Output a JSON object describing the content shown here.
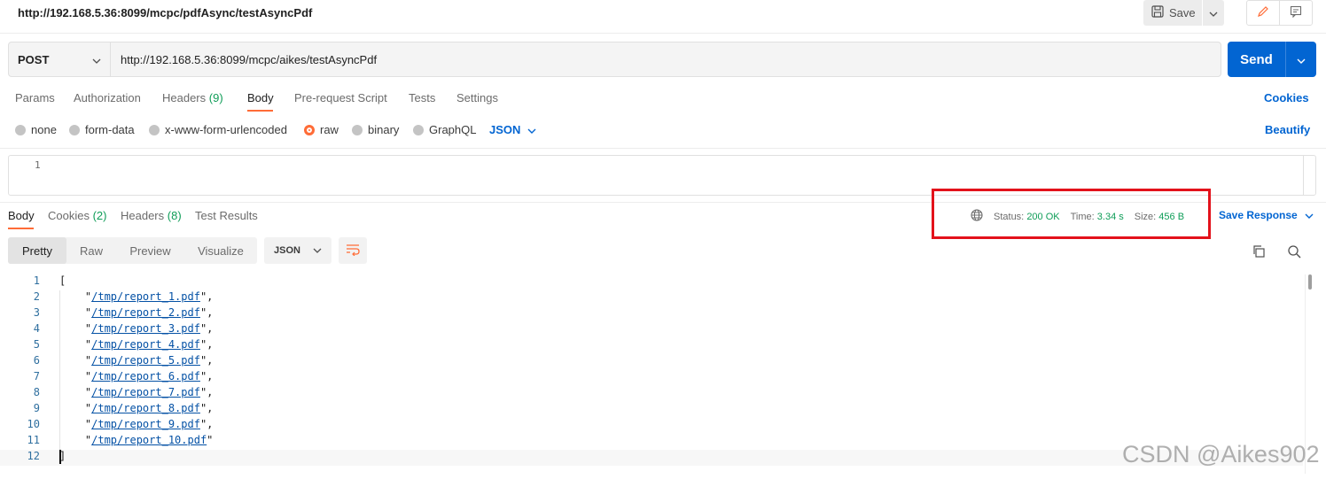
{
  "request": {
    "title": "http://192.168.5.36:8099/mcpc/pdfAsync/testAsyncPdf",
    "save_label": "Save",
    "method": "POST",
    "url": "http://192.168.5.36:8099/mcpc/aikes/testAsyncPdf",
    "send_label": "Send"
  },
  "request_tabs": [
    {
      "label": "Params",
      "count": ""
    },
    {
      "label": "Authorization",
      "count": ""
    },
    {
      "label": "Headers",
      "count": "(9)"
    },
    {
      "label": "Body",
      "count": ""
    },
    {
      "label": "Pre-request Script",
      "count": ""
    },
    {
      "label": "Tests",
      "count": ""
    },
    {
      "label": "Settings",
      "count": ""
    }
  ],
  "active_request_tab": "Body",
  "cookies_label": "Cookies",
  "body_types": [
    "none",
    "form-data",
    "x-www-form-urlencoded",
    "raw",
    "binary",
    "GraphQL"
  ],
  "selected_body_type": "raw",
  "raw_language": "JSON",
  "beautify_label": "Beautify",
  "request_editor": {
    "line_numbers": [
      "1"
    ]
  },
  "response_tabs": [
    {
      "label": "Body",
      "count": ""
    },
    {
      "label": "Cookies",
      "count": "(2)"
    },
    {
      "label": "Headers",
      "count": "(8)"
    },
    {
      "label": "Test Results",
      "count": ""
    }
  ],
  "status": {
    "status_label": "Status:",
    "status_value": "200 OK",
    "time_label": "Time:",
    "time_value": "3.34 s",
    "size_label": "Size:",
    "size_value": "456 B",
    "highlight_color": "#e3121b"
  },
  "save_response_label": "Save Response",
  "view_modes": [
    "Pretty",
    "Raw",
    "Preview",
    "Visualize"
  ],
  "active_view_mode": "Pretty",
  "response_format": "JSON",
  "response_lines": [
    {
      "num": "1",
      "pre": "[",
      "str": "",
      "post": ""
    },
    {
      "num": "2",
      "pre": "    \"",
      "str": "/tmp/report_1.pdf",
      "post": "\","
    },
    {
      "num": "3",
      "pre": "    \"",
      "str": "/tmp/report_2.pdf",
      "post": "\","
    },
    {
      "num": "4",
      "pre": "    \"",
      "str": "/tmp/report_3.pdf",
      "post": "\","
    },
    {
      "num": "5",
      "pre": "    \"",
      "str": "/tmp/report_4.pdf",
      "post": "\","
    },
    {
      "num": "6",
      "pre": "    \"",
      "str": "/tmp/report_5.pdf",
      "post": "\","
    },
    {
      "num": "7",
      "pre": "    \"",
      "str": "/tmp/report_6.pdf",
      "post": "\","
    },
    {
      "num": "8",
      "pre": "    \"",
      "str": "/tmp/report_7.pdf",
      "post": "\","
    },
    {
      "num": "9",
      "pre": "    \"",
      "str": "/tmp/report_8.pdf",
      "post": "\","
    },
    {
      "num": "10",
      "pre": "    \"",
      "str": "/tmp/report_9.pdf",
      "post": "\","
    },
    {
      "num": "11",
      "pre": "    \"",
      "str": "/tmp/report_10.pdf",
      "post": "\""
    },
    {
      "num": "12",
      "pre": "]",
      "str": "",
      "post": ""
    }
  ],
  "watermark": "CSDN @Aikes902",
  "colors": {
    "accent": "#ff6c37",
    "primary": "#0265d2",
    "success": "#0f9d58"
  }
}
